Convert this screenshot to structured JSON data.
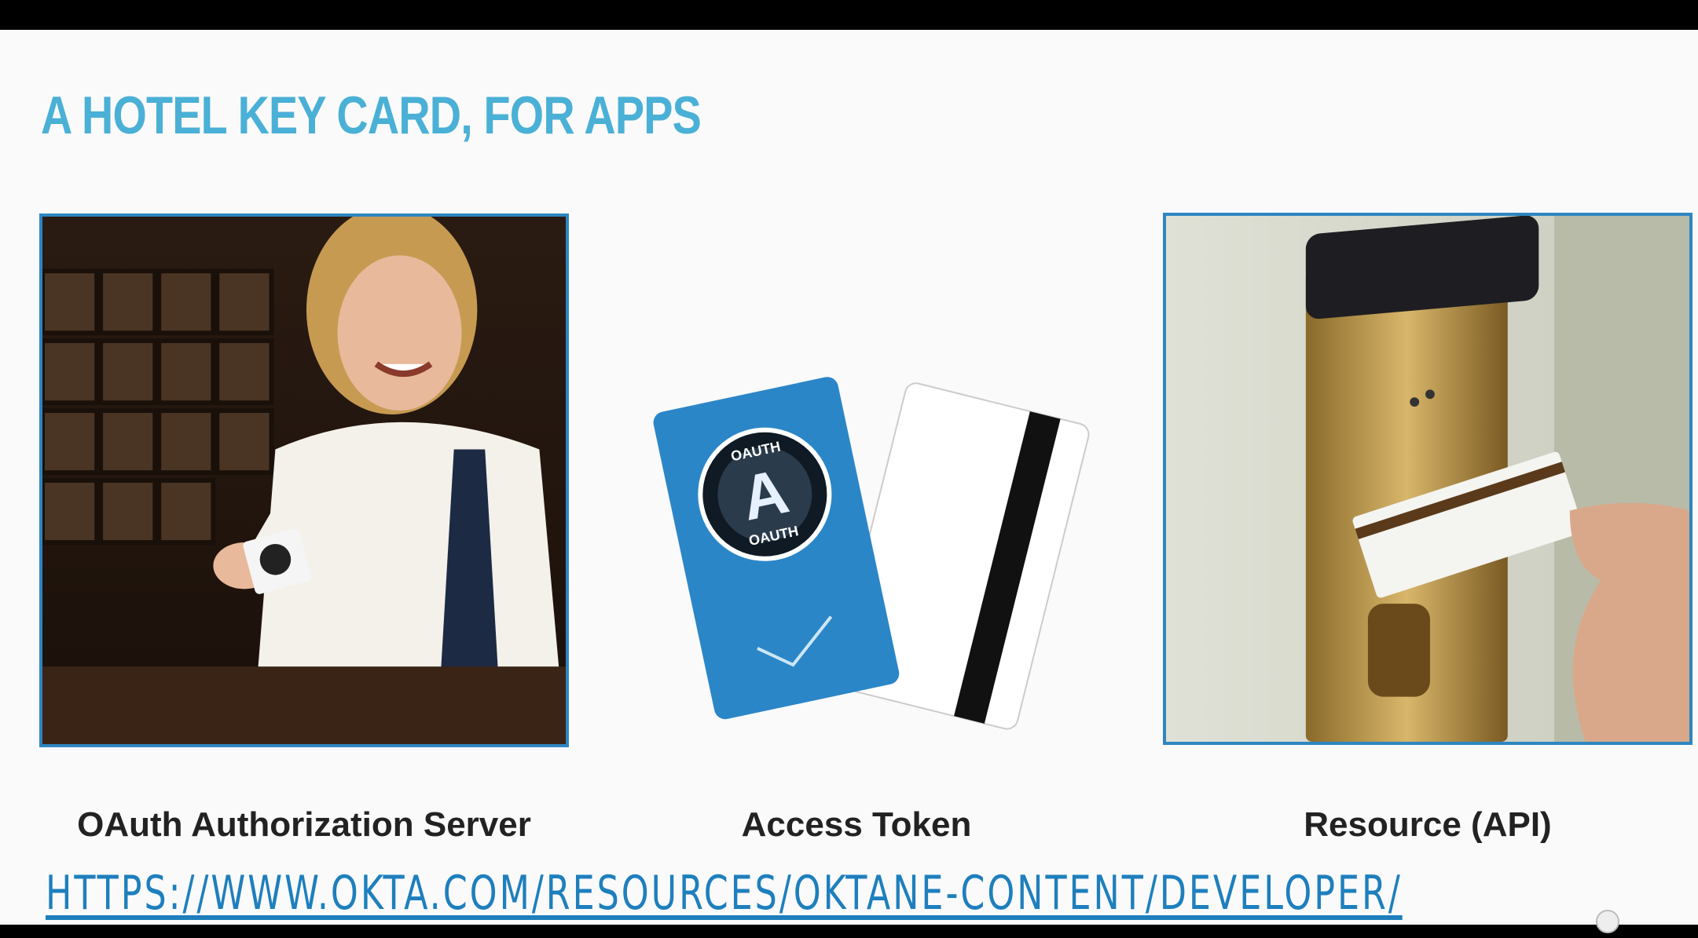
{
  "slide": {
    "title": "A HOTEL KEY CARD, FOR APPS",
    "panels": [
      {
        "caption": "OAuth Authorization Server",
        "image": "hotel-receptionist-photo"
      },
      {
        "caption": "Access Token",
        "image": "oauth-key-cards-illustration"
      },
      {
        "caption": "Resource (API)",
        "image": "hotel-door-lock-photo"
      }
    ],
    "link": "HTTPS://WWW.OKTA.COM/RESOURCES/OKTANE-CONTENT/DEVELOPER/",
    "badge": {
      "top": "OAUTH",
      "bottom": "OAUTH",
      "letter": "A"
    }
  },
  "colors": {
    "title": "#4ab0d6",
    "frame": "#2e86c1",
    "card": "#2b86c8",
    "link": "#1e7fbd"
  }
}
